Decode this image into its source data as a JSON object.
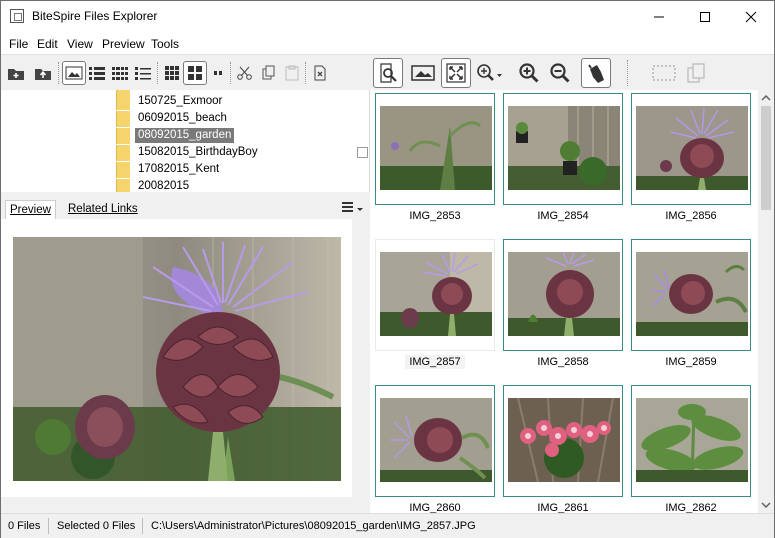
{
  "window": {
    "title": "BiteSpire Files Explorer"
  },
  "menu": [
    "File",
    "Edit",
    "View",
    "Preview",
    "Tools"
  ],
  "tree": {
    "folders": [
      {
        "name": "150725_Exmoor",
        "selected": false
      },
      {
        "name": "06092015_beach",
        "selected": false
      },
      {
        "name": "08092015_garden",
        "selected": true
      },
      {
        "name": "15082015_BirthdayBoy",
        "selected": false
      },
      {
        "name": "17082015_Kent",
        "selected": false
      },
      {
        "name": "20082015",
        "selected": false
      }
    ]
  },
  "tabs": [
    {
      "label": "Preview",
      "active": true
    },
    {
      "label": "Related Links",
      "active": false
    }
  ],
  "thumbnails": [
    {
      "name": "IMG_2853",
      "scene": "wall-plant",
      "selected": false
    },
    {
      "name": "IMG_2854",
      "scene": "corner-pots",
      "selected": false
    },
    {
      "name": "IMG_2856",
      "scene": "artichoke",
      "selected": false
    },
    {
      "name": "IMG_2857",
      "scene": "artichoke2",
      "selected": true
    },
    {
      "name": "IMG_2858",
      "scene": "artichoke3",
      "selected": false
    },
    {
      "name": "IMG_2859",
      "scene": "artichoke-side",
      "selected": false
    },
    {
      "name": "IMG_2860",
      "scene": "artichoke-side2",
      "selected": false
    },
    {
      "name": "IMG_2861",
      "scene": "pink-flowers",
      "selected": false
    },
    {
      "name": "IMG_2862",
      "scene": "fern",
      "selected": false
    }
  ],
  "status": {
    "files": "0 Files",
    "selected": "Selected 0 Files",
    "path": "C:\\Users\\Administrator\\Pictures\\08092015_garden\\IMG_2857.JPG"
  },
  "colors": {
    "accent": "#3b8a8a",
    "selection": "#7a7a7a"
  }
}
